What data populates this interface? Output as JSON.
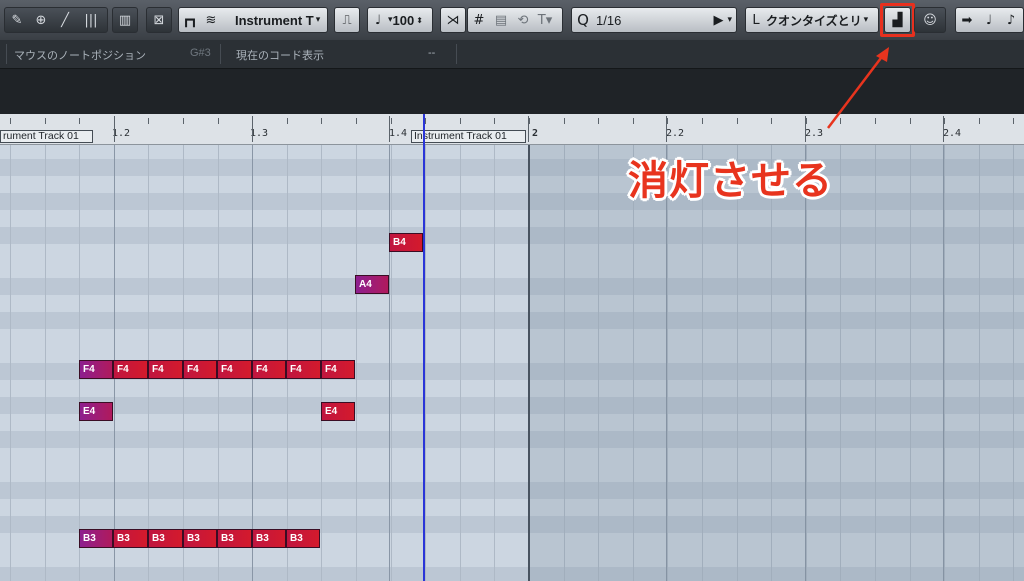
{
  "toolbar": {
    "tools_icons": [
      "pencil-icon",
      "zoom-icon",
      "line-icon",
      "split-icon"
    ],
    "track_name": "Instrument T",
    "velocity": "100",
    "quantize_value": "1/16",
    "quantize_preset": "クオンタイズとリ",
    "highlight_color": "#e8301e"
  },
  "infobar": {
    "mouse_label": "マウスのノートポジション",
    "mouse_value": "G#3",
    "chord_label": "現在のコード表示",
    "chord_value": "--"
  },
  "ruler": {
    "labels": [
      "1.2",
      "1.3",
      "1.4",
      "2",
      "2.2",
      "2.3",
      "2.4"
    ],
    "track_label": "Instrument Track 01",
    "track_label_left": "rument Track 01"
  },
  "notes": [
    {
      "label": "B4",
      "color": "red"
    },
    {
      "label": "A4",
      "color": "purple"
    },
    {
      "label": "F4",
      "color": "purple"
    },
    {
      "label": "F4",
      "color": "red"
    },
    {
      "label": "F4",
      "color": "red"
    },
    {
      "label": "F4",
      "color": "red"
    },
    {
      "label": "F4",
      "color": "red"
    },
    {
      "label": "F4",
      "color": "red"
    },
    {
      "label": "F4",
      "color": "red"
    },
    {
      "label": "F4",
      "color": "red"
    },
    {
      "label": "E4",
      "color": "purple"
    },
    {
      "label": "E4",
      "color": "red"
    },
    {
      "label": "B3",
      "color": "purple"
    },
    {
      "label": "B3",
      "color": "red"
    },
    {
      "label": "B3",
      "color": "red"
    },
    {
      "label": "B3",
      "color": "red"
    },
    {
      "label": "B3",
      "color": "red"
    },
    {
      "label": "B3",
      "color": "red"
    },
    {
      "label": "B3",
      "color": "red"
    }
  ],
  "annotation": "消灯させる"
}
